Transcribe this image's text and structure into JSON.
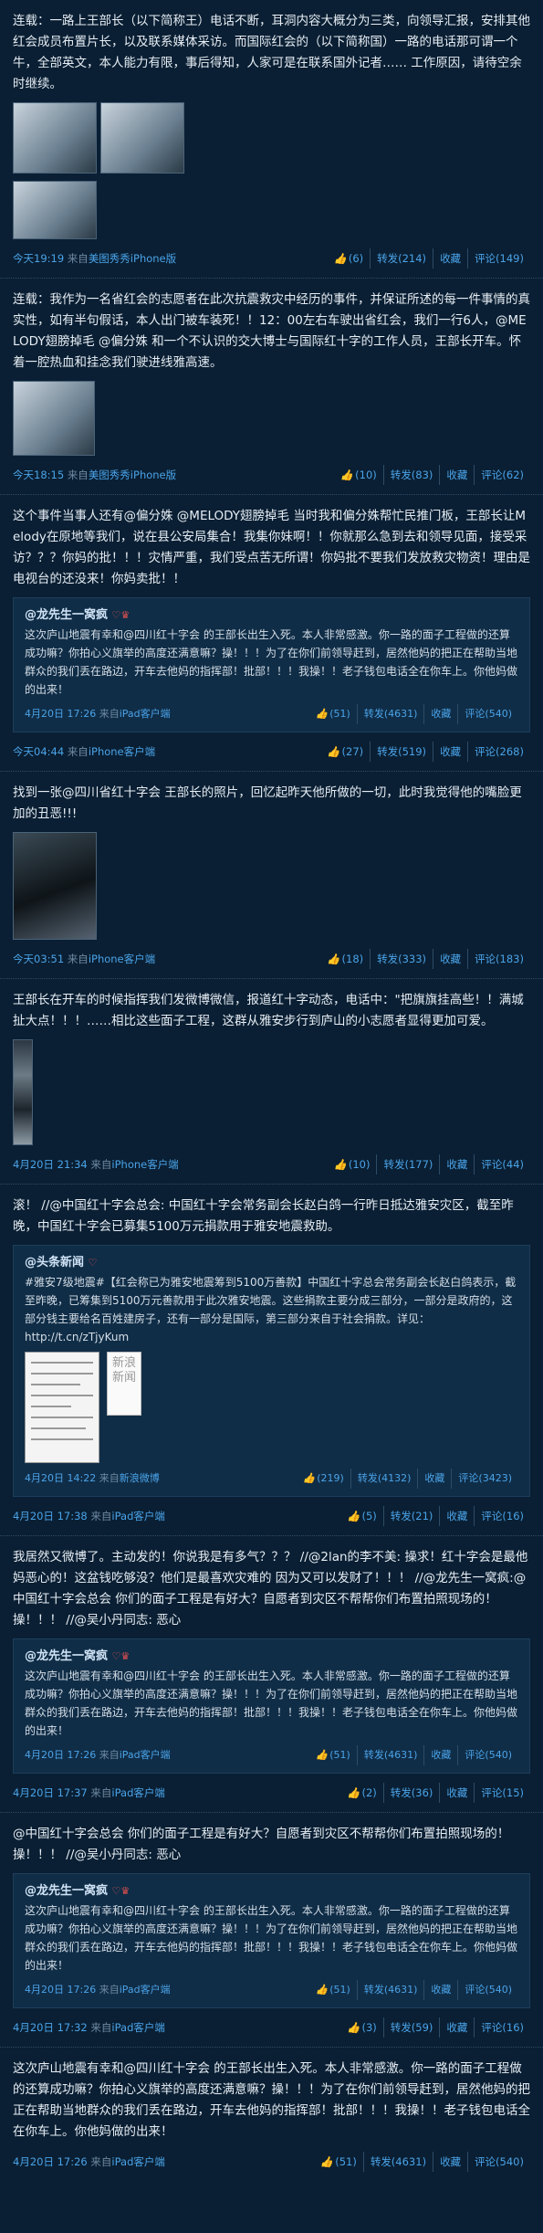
{
  "posts": [
    {
      "text": "连载：一路上王部长（以下简称王）电话不断，耳洞内容大概分为三类，向领导汇报，安排其他红会成员布置片长，以及联系媒体采访。而国际红会的（以下简称国）一路的电话那可谓一个牛，全部英文，本人能力有限，事后得知，人家可是在联系国外记者…… 工作原因，请待空余时继续。",
      "time": "今天19:19",
      "source_prefix": "来自",
      "source": "美图秀秀iPhone版",
      "likes": "(6)",
      "repost": "转发(214)",
      "fav": "收藏",
      "comment": "评论(149)"
    },
    {
      "text": "连载：我作为一名省红会的志愿者在此次抗震救灾中经历的事件，并保证所述的每一件事情的真实性，如有半句假话，本人出门被车装死！！12：00左右车驶出省红会，我们一行6人，@MELODY翅膀掉毛 @偏分姝 和一个不认识的交大博士与国际红十字的工作人员，王部长开车。怀着一腔热血和挂念我们驶进线雅高速。",
      "time": "今天18:15",
      "source_prefix": "来自",
      "source": "美图秀秀iPhone版",
      "likes": "(10)",
      "repost": "转发(83)",
      "fav": "收藏",
      "comment": "评论(62)"
    },
    {
      "text": "这个事件当事人还有@偏分姝 @MELODY翅膀掉毛 当时我和偏分姝帮忙民推门板，王部长让Melody在原地等我们，说在县公安局集合！我集你妹啊！！你就那么急到去和领导见面，接受采访？？？你妈的批！！！灾情严重，我们受点苦无所谓！你妈批不要我们发放救灾物资！理由是电视台的还没来！你妈卖批！！",
      "repost": {
        "author": "@龙先生一窝疯",
        "badge": "♡♛",
        "text": "这次庐山地震有幸和@四川红十字会 的王部长出生入死。本人非常感激。你一路的面子工程做的还算成功嘛？你拍心义旗举的高度还满意嘛？操！！！为了在你们前领导赶到，居然他妈的把正在帮助当地群众的我们丢在路边，开车去他妈的指挥部！批部！！！我操！！老子钱包电话全在你车上。你他妈做的出来！",
        "time": "4月20日 17:26",
        "source_prefix": "来自",
        "source": "iPad客户端",
        "likes": "(51)",
        "repost": "转发(4631)",
        "fav": "收藏",
        "comment": "评论(540)"
      },
      "time": "今天04:44",
      "source_prefix": "来自",
      "source": "iPhone客户端",
      "likes": "(27)",
      "repost_c": "转发(519)",
      "fav": "收藏",
      "comment": "评论(268)"
    },
    {
      "text": "找到一张@四川省红十字会 王部长的照片，回忆起昨天他所做的一切，此时我觉得他的嘴脸更加的丑恶!!!",
      "time": "今天03:51",
      "source_prefix": "来自",
      "source": "iPhone客户端",
      "likes": "(18)",
      "repost": "转发(333)",
      "fav": "收藏",
      "comment": "评论(183)"
    },
    {
      "text": "王部长在开车的时候指挥我们发微博微信，报道红十字动态，电话中：\"把旗旗挂高些！！满城扯大点！！！……相比这些面子工程，这群从雅安步行到庐山的小志愿者显得更加可爱。",
      "time": "4月20日 21:34",
      "source_prefix": "来自",
      "source": "iPhone客户端",
      "likes": "(10)",
      "repost": "转发(177)",
      "fav": "收藏",
      "comment": "评论(44)"
    },
    {
      "text": "滚！ //@中国红十字会总会: 中国红十字会常务副会长赵白鸽一行昨日抵达雅安灾区，截至昨晚，中国红十字会已募集5100万元捐款用于雅安地震救助。",
      "repost": {
        "author": "@头条新闻",
        "badge": "♡",
        "text": "#雅安7级地震#【红会称已为雅安地震筹到5100万善款】中国红十字总会常务副会长赵白鸽表示，截至昨晚，已筹集到5100万元善款用于此次雅安地震。这些捐款主要分成三部分，一部分是政府的，这部分钱主要给名百姓建房子，还有一部分是国际，第三部分来自于社会捐款。详见：http://t.cn/zTjyKum",
        "doc_title": "新浪新闻",
        "time": "4月20日 14:22",
        "source_prefix": "来自",
        "source": "新浪微博",
        "likes": "(219)",
        "repost": "转发(4132)",
        "fav": "收藏",
        "comment": "评论(3423)"
      },
      "time": "4月20日 17:38",
      "source_prefix": "来自",
      "source": "iPad客户端",
      "likes": "(5)",
      "repost_c": "转发(21)",
      "fav": "收藏",
      "comment": "评论(16)"
    },
    {
      "text": "我居然又微博了。主动发的！你说我是有多气？？？ //@2lan的李不美: 操求！红十字会是最他妈恶心的！这盆钱吃够没？他们是最喜欢灾难的 因为又可以发财了！！！ //@龙先生一窝疯:@中国红十字会总会 你们的面子工程是有好大？自愿者到灾区不帮帮你们布置拍照现场的！操！！！ //@吴小丹同志: 恶心",
      "repost": {
        "author": "@龙先生一窝疯",
        "badge": "♡♛",
        "text": "这次庐山地震有幸和@四川红十字会 的王部长出生入死。本人非常感激。你一路的面子工程做的还算成功嘛？你拍心义旗举的高度还满意嘛？操！！！为了在你们前领导赶到，居然他妈的把正在帮助当地群众的我们丢在路边，开车去他妈的指挥部！批部！！！我操！！老子钱包电话全在你车上。你他妈做的出来！",
        "time": "4月20日 17:26",
        "source_prefix": "来自",
        "source": "iPad客户端",
        "likes": "(51)",
        "repost": "转发(4631)",
        "fav": "收藏",
        "comment": "评论(540)"
      },
      "time": "4月20日 17:37",
      "source_prefix": "来自",
      "source": "iPad客户端",
      "likes": "(2)",
      "repost_c": "转发(36)",
      "fav": "收藏",
      "comment": "评论(15)"
    },
    {
      "text": "@中国红十字会总会 你们的面子工程是有好大？自愿者到灾区不帮帮你们布置拍照现场的！操！！！ //@吴小丹同志: 恶心",
      "repost": {
        "author": "@龙先生一窝疯",
        "badge": "♡♛",
        "text": "这次庐山地震有幸和@四川红十字会 的王部长出生入死。本人非常感激。你一路的面子工程做的还算成功嘛？你拍心义旗举的高度还满意嘛？操！！！为了在你们前领导赶到，居然他妈的把正在帮助当地群众的我们丢在路边，开车去他妈的指挥部！批部！！！我操！！老子钱包电话全在你车上。你他妈做的出来！",
        "time": "4月20日 17:26",
        "source_prefix": "来自",
        "source": "iPad客户端",
        "likes": "(51)",
        "repost": "转发(4631)",
        "fav": "收藏",
        "comment": "评论(540)"
      },
      "time": "4月20日 17:32",
      "source_prefix": "来自",
      "source": "iPad客户端",
      "likes": "(3)",
      "repost_c": "转发(59)",
      "fav": "收藏",
      "comment": "评论(16)"
    },
    {
      "text": "这次庐山地震有幸和@四川红十字会 的王部长出生入死。本人非常感激。你一路的面子工程做的还算成功嘛？你拍心义旗举的高度还满意嘛？操！！！为了在你们前领导赶到，居然他妈的把正在帮助当地群众的我们丢在路边，开车去他妈的指挥部！批部！！！我操！！老子钱包电话全在你车上。你他妈做的出来！",
      "time": "4月20日 17:26",
      "source_prefix": "来自",
      "source": "iPad客户端",
      "likes": "(51)",
      "repost": "转发(4631)",
      "fav": "收藏",
      "comment": "评论(540)"
    }
  ],
  "icons": {
    "like": "thumb-up-icon"
  }
}
